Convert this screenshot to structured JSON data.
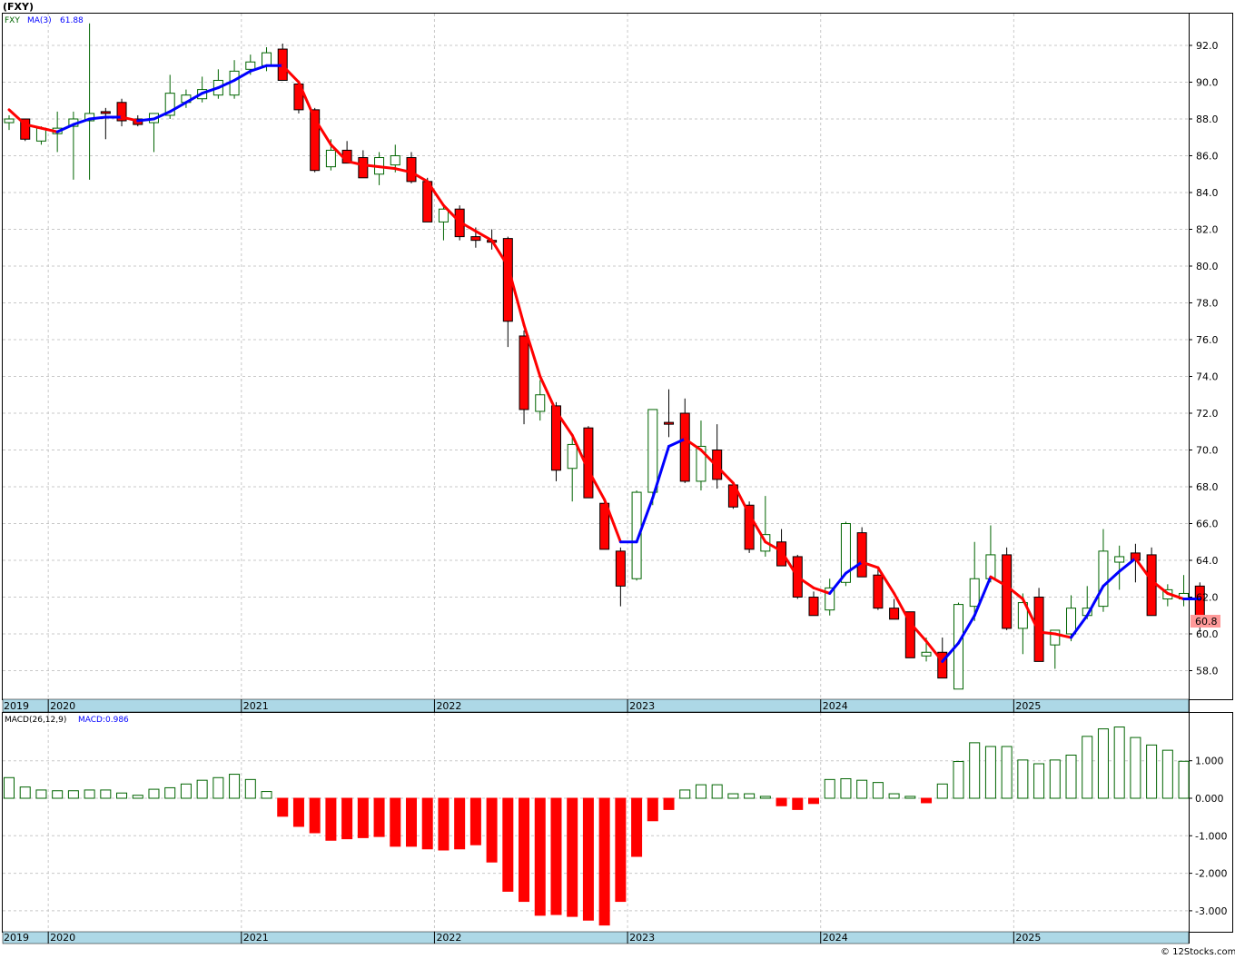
{
  "title": "(FXY)",
  "watermark": "© 12Stocks.com",
  "colors": {
    "up": "#006400",
    "down": "#ff0000",
    "ma_up": "#0000ff",
    "ma_down": "#ff0000",
    "axis_band": "#add8e6",
    "grid": "#c8c8c8",
    "last_label_bg": "#ff9999"
  },
  "chart_data": [
    {
      "type": "candlestick",
      "legend": {
        "symbol": "FXY",
        "ma_label": "MA(3)",
        "ma_value": "61.88"
      },
      "ylim": [
        57,
        93.8
      ],
      "yticks": [
        "58.0",
        "60.0",
        "62.0",
        "64.0",
        "66.0",
        "68.0",
        "70.0",
        "72.0",
        "74.0",
        "76.0",
        "78.0",
        "80.0",
        "82.0",
        "84.0",
        "86.0",
        "88.0",
        "90.0",
        "92.0"
      ],
      "last_value_label": "60.8",
      "candles": [
        [
          87.8,
          88.2,
          87.4,
          88.0
        ],
        [
          88.0,
          88.0,
          86.8,
          86.9
        ],
        [
          86.8,
          87.6,
          86.6,
          87.5
        ],
        [
          87.2,
          88.4,
          86.2,
          87.5
        ],
        [
          87.6,
          88.4,
          84.7,
          88.0
        ],
        [
          87.9,
          93.2,
          84.7,
          88.3
        ],
        [
          88.4,
          88.6,
          86.9,
          88.3
        ],
        [
          88.9,
          89.1,
          87.6,
          87.9
        ],
        [
          88.0,
          88.2,
          87.6,
          87.7
        ],
        [
          87.8,
          88.2,
          86.2,
          88.3
        ],
        [
          88.2,
          90.4,
          88.0,
          89.4
        ],
        [
          88.9,
          89.6,
          88.6,
          89.3
        ],
        [
          89.1,
          90.3,
          88.9,
          89.6
        ],
        [
          89.3,
          90.7,
          89.1,
          90.1
        ],
        [
          89.3,
          91.2,
          89.1,
          90.6
        ],
        [
          90.7,
          91.5,
          90.4,
          91.1
        ],
        [
          90.9,
          91.9,
          90.6,
          91.6
        ],
        [
          91.8,
          92.1,
          90.1,
          90.1
        ],
        [
          89.9,
          90.1,
          88.3,
          88.5
        ],
        [
          88.5,
          88.6,
          85.1,
          85.2
        ],
        [
          85.4,
          86.9,
          85.2,
          86.3
        ],
        [
          86.3,
          86.8,
          85.7,
          85.6
        ],
        [
          85.9,
          86.3,
          85.1,
          84.8
        ],
        [
          85.0,
          86.2,
          84.4,
          85.9
        ],
        [
          85.5,
          86.6,
          85.1,
          86.0
        ],
        [
          85.9,
          86.2,
          84.5,
          84.6
        ],
        [
          84.6,
          84.8,
          82.5,
          82.4
        ],
        [
          82.4,
          83.3,
          81.4,
          83.1
        ],
        [
          83.1,
          83.3,
          81.4,
          81.6
        ],
        [
          81.6,
          82.1,
          81.0,
          81.4
        ],
        [
          81.4,
          82.0,
          80.9,
          81.3
        ],
        [
          81.5,
          81.6,
          75.6,
          77.0
        ],
        [
          76.2,
          76.5,
          71.4,
          72.2
        ],
        [
          72.1,
          73.8,
          71.6,
          73.0
        ],
        [
          72.4,
          72.6,
          68.3,
          68.9
        ],
        [
          69.0,
          70.9,
          67.2,
          70.3
        ],
        [
          71.2,
          71.3,
          67.4,
          67.4
        ],
        [
          67.1,
          67.2,
          64.6,
          64.6
        ],
        [
          64.5,
          64.7,
          61.5,
          62.6
        ],
        [
          63.0,
          67.8,
          62.9,
          67.7
        ],
        [
          67.7,
          72.1,
          67.0,
          72.2
        ],
        [
          71.5,
          73.3,
          70.7,
          71.4
        ],
        [
          72.0,
          72.8,
          68.2,
          68.3
        ],
        [
          68.3,
          71.6,
          67.8,
          70.2
        ],
        [
          70.0,
          71.4,
          67.9,
          68.4
        ],
        [
          68.1,
          68.2,
          66.8,
          66.9
        ],
        [
          67.0,
          67.2,
          64.4,
          64.6
        ],
        [
          64.5,
          67.5,
          64.2,
          65.4
        ],
        [
          65.0,
          65.7,
          63.7,
          63.7
        ],
        [
          64.2,
          64.3,
          61.9,
          62.0
        ],
        [
          62.0,
          62.3,
          61.1,
          61.0
        ],
        [
          61.3,
          63.0,
          61.0,
          62.5
        ],
        [
          62.8,
          66.1,
          62.6,
          66.0
        ],
        [
          65.5,
          65.8,
          63.1,
          63.1
        ],
        [
          63.2,
          63.6,
          61.3,
          61.4
        ],
        [
          61.4,
          61.9,
          60.8,
          60.8
        ],
        [
          61.2,
          61.2,
          58.7,
          58.7
        ],
        [
          58.8,
          59.8,
          58.5,
          59.0
        ],
        [
          59.0,
          59.8,
          57.6,
          57.6
        ],
        [
          57.0,
          61.7,
          57.2,
          61.6
        ],
        [
          61.5,
          65.0,
          60.7,
          63.0
        ],
        [
          63.0,
          65.9,
          62.8,
          64.3
        ],
        [
          64.3,
          64.7,
          60.2,
          60.3
        ],
        [
          60.3,
          62.2,
          58.9,
          61.7
        ],
        [
          62.0,
          62.5,
          58.5,
          58.5
        ],
        [
          59.4,
          60.2,
          58.1,
          60.2
        ],
        [
          60.0,
          62.1,
          59.6,
          61.4
        ],
        [
          61.0,
          62.6,
          60.8,
          61.4
        ],
        [
          61.5,
          65.7,
          61.2,
          64.5
        ],
        [
          63.9,
          64.8,
          62.4,
          64.2
        ],
        [
          64.4,
          64.9,
          62.8,
          64.0
        ],
        [
          64.3,
          64.7,
          61.0,
          61.0
        ],
        [
          61.9,
          62.7,
          61.5,
          62.4
        ],
        [
          61.9,
          63.2,
          61.5,
          62.2
        ],
        [
          62.6,
          62.8,
          60.1,
          60.8
        ]
      ],
      "ma3": [
        88.5,
        87.7,
        87.5,
        87.3,
        87.7,
        88.0,
        88.1,
        88.1,
        87.9,
        88.0,
        88.4,
        88.9,
        89.4,
        89.7,
        90.1,
        90.6,
        90.9,
        90.9,
        90.0,
        88.0,
        86.6,
        85.7,
        85.5,
        85.4,
        85.3,
        85.1,
        84.6,
        83.3,
        82.4,
        81.9,
        81.4,
        80.0,
        76.8,
        74.0,
        72.1,
        70.8,
        68.9,
        67.3,
        65.0,
        65.0,
        67.4,
        70.2,
        70.6,
        70.0,
        69.1,
        68.2,
        66.5,
        65.0,
        64.5,
        63.1,
        62.5,
        62.2,
        63.3,
        63.9,
        63.6,
        62.2,
        60.6,
        59.6,
        58.5,
        59.5,
        61.0,
        63.1,
        62.6,
        61.9,
        60.1,
        60.0,
        59.8,
        61.0,
        62.6,
        63.4,
        64.1,
        62.9,
        62.2,
        61.9,
        61.9
      ],
      "xticks": [
        {
          "label": "2019",
          "pos": 0
        },
        {
          "label": "2020",
          "pos": 3
        },
        {
          "label": "2021",
          "pos": 15
        },
        {
          "label": "2022",
          "pos": 27
        },
        {
          "label": "2023",
          "pos": 39
        },
        {
          "label": "2024",
          "pos": 51
        },
        {
          "label": "2025",
          "pos": 63
        }
      ]
    },
    {
      "type": "bar",
      "legend": {
        "label": "MACD(26,12,9)",
        "value_label": "MACD:0.986"
      },
      "ylim": [
        -3.55,
        2.2
      ],
      "yticks": [
        {
          "label": "1.000",
          "v": 1
        },
        {
          "label": "0.000",
          "v": 0
        },
        {
          "label": "-1.000",
          "v": -1
        },
        {
          "label": "-2.000",
          "v": -2
        },
        {
          "label": "-3.000",
          "v": -3
        }
      ],
      "values": [
        0.55,
        0.3,
        0.22,
        0.2,
        0.2,
        0.22,
        0.22,
        0.14,
        0.08,
        0.24,
        0.28,
        0.38,
        0.48,
        0.55,
        0.64,
        0.5,
        0.18,
        -0.48,
        -0.75,
        -0.92,
        -1.12,
        -1.08,
        -1.05,
        -1.02,
        -1.28,
        -1.28,
        -1.35,
        -1.38,
        -1.35,
        -1.24,
        -1.7,
        -2.48,
        -2.75,
        -3.12,
        -3.1,
        -3.15,
        -3.25,
        -3.38,
        -2.75,
        -1.55,
        -0.6,
        -0.3,
        0.22,
        0.36,
        0.36,
        0.12,
        0.12,
        0.05,
        -0.2,
        -0.3,
        -0.14,
        0.5,
        0.52,
        0.48,
        0.42,
        0.12,
        0.05,
        -0.12,
        0.38,
        0.98,
        1.48,
        1.38,
        1.38,
        1.02,
        0.92,
        1.02,
        1.15,
        1.65,
        1.85,
        1.9,
        1.62,
        1.42,
        1.28,
        0.986
      ],
      "xticks": [
        {
          "label": "2019",
          "pos": 0
        },
        {
          "label": "2020",
          "pos": 3
        },
        {
          "label": "2021",
          "pos": 15
        },
        {
          "label": "2022",
          "pos": 27
        },
        {
          "label": "2023",
          "pos": 39
        },
        {
          "label": "2024",
          "pos": 51
        },
        {
          "label": "2025",
          "pos": 63
        }
      ]
    }
  ]
}
